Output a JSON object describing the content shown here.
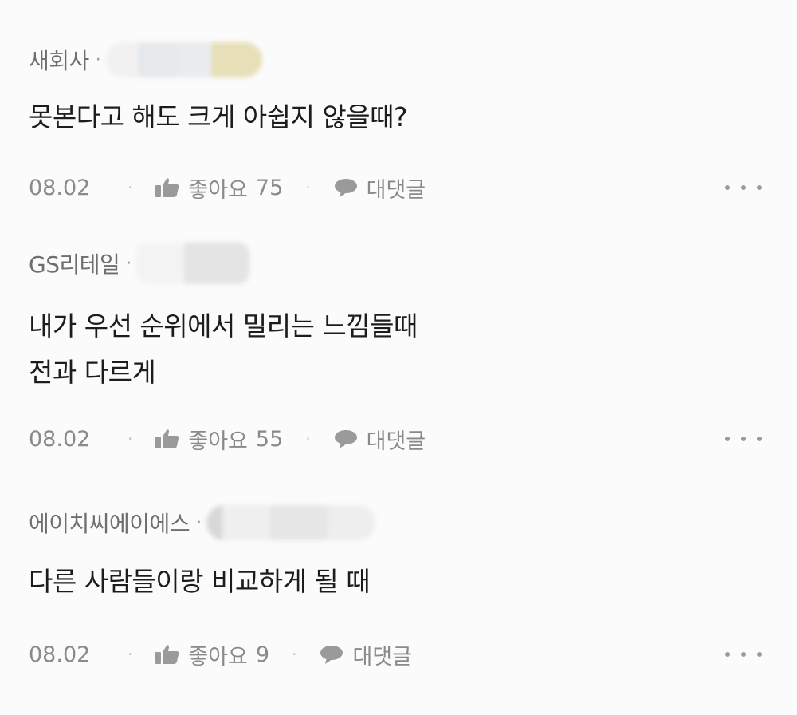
{
  "comments": [
    {
      "company": "새회사",
      "separator": "·",
      "lines": [
        "못본다고 해도 크게 아쉽지 않을때?"
      ],
      "date": "08.02",
      "like_label": "좋아요",
      "like_count": "75",
      "reply_label": "대댓글"
    },
    {
      "company": "GS리테일",
      "separator": "·",
      "lines": [
        "내가 우선 순위에서 밀리는 느낌들때",
        "전과 다르게"
      ],
      "date": "08.02",
      "like_label": "좋아요",
      "like_count": "55",
      "reply_label": "대댓글"
    },
    {
      "company": "에이치씨에이에스",
      "separator": "·",
      "lines": [
        "다른 사람들이랑 비교하게 될 때"
      ],
      "date": "08.02",
      "like_label": "좋아요",
      "like_count": "9",
      "reply_label": "대댓글"
    }
  ],
  "icons": {
    "like": "thumbs-up-icon",
    "reply": "speech-bubble-icon",
    "more": "more-dots-icon"
  },
  "colors": {
    "background": "#fbfbfb",
    "text": "#1c1c1c",
    "meta": "#8a8a8a"
  }
}
